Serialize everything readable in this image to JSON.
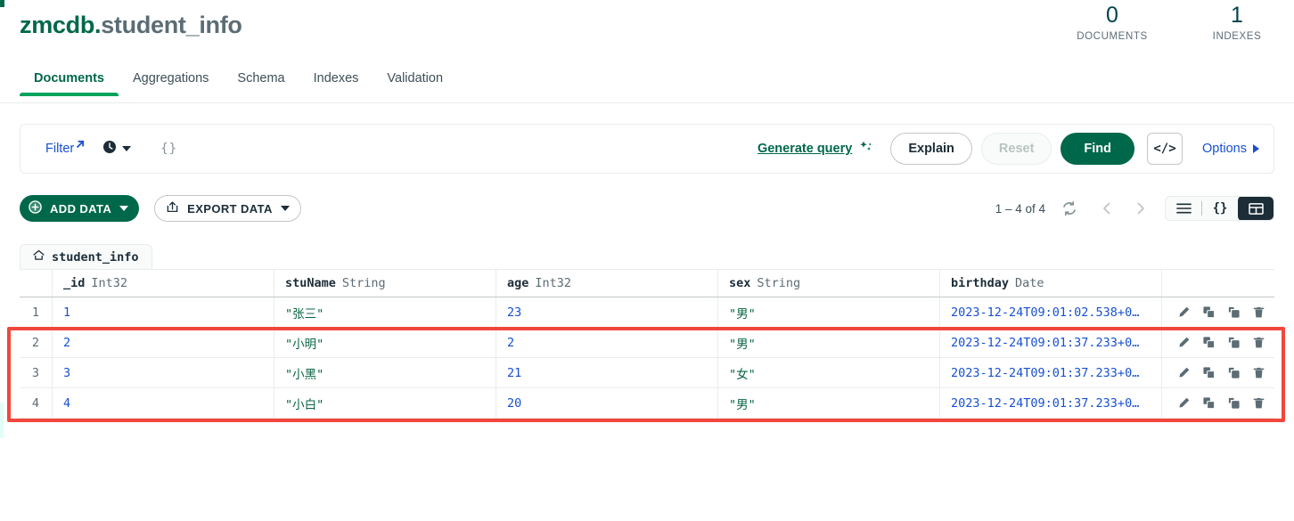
{
  "header": {
    "db_name": "zmcdb.",
    "collection_name": "student_info",
    "stats": [
      {
        "num": "0",
        "label": "DOCUMENTS"
      },
      {
        "num": "1",
        "label": "INDEXES"
      }
    ]
  },
  "tabs": [
    {
      "label": "Documents",
      "active": true
    },
    {
      "label": "Aggregations",
      "active": false
    },
    {
      "label": "Schema",
      "active": false
    },
    {
      "label": "Indexes",
      "active": false
    },
    {
      "label": "Validation",
      "active": false
    }
  ],
  "querybar": {
    "filter_label": "Filter",
    "filter_value": "{}",
    "generate_query_label": "Generate query",
    "explain_label": "Explain",
    "reset_label": "Reset",
    "find_label": "Find",
    "code_label": "</>",
    "options_label": "Options",
    "history_icon": "clock-icon",
    "external_link_icon": "external-link-icon",
    "sparkle_icon": "sparkle-icon"
  },
  "crudbar": {
    "add_data_label": "ADD DATA",
    "export_data_label": "EXPORT DATA",
    "range_label": "1 – 4 of 4",
    "refresh_icon": "refresh-icon",
    "prev_icon": "chevron-left-icon",
    "next_icon": "chevron-right-icon",
    "view_list_icon": "list-view-icon",
    "view_json_label": "{}",
    "view_table_icon": "table-view-icon",
    "active_view": "table"
  },
  "breadcrumb": {
    "home_icon": "home-icon",
    "label": "student_info"
  },
  "table": {
    "columns": [
      {
        "field": "_id",
        "type": "Int32"
      },
      {
        "field": "stuName",
        "type": "String"
      },
      {
        "field": "age",
        "type": "Int32"
      },
      {
        "field": "sex",
        "type": "String"
      },
      {
        "field": "birthday",
        "type": "Date"
      }
    ],
    "rows": [
      {
        "index": "1",
        "_id": "1",
        "stuName": "\"张三\"",
        "age": "23",
        "sex": "\"男\"",
        "birthday": "2023-12-24T09:01:02.538+0…"
      },
      {
        "index": "2",
        "_id": "2",
        "stuName": "\"小明\"",
        "age": "2",
        "sex": "\"男\"",
        "birthday": "2023-12-24T09:01:37.233+0…"
      },
      {
        "index": "3",
        "_id": "3",
        "stuName": "\"小黑\"",
        "age": "21",
        "sex": "\"女\"",
        "birthday": "2023-12-24T09:01:37.233+0…"
      },
      {
        "index": "4",
        "_id": "4",
        "stuName": "\"小白\"",
        "age": "20",
        "sex": "\"男\"",
        "birthday": "2023-12-24T09:01:37.233+0…"
      }
    ],
    "row_actions": [
      "edit-icon",
      "copy-icon",
      "clone-icon",
      "delete-icon"
    ]
  },
  "annotation": {
    "highlight_color": "#F1463C",
    "highlight_rows": [
      "2",
      "3",
      "4"
    ]
  },
  "colors": {
    "brand_green": "#00684A",
    "accent_green": "#00A35C",
    "link_blue": "#1750D1",
    "value_string": "#0A6640",
    "text_dark": "#1C2D38",
    "text_muted": "#5C6C75"
  }
}
